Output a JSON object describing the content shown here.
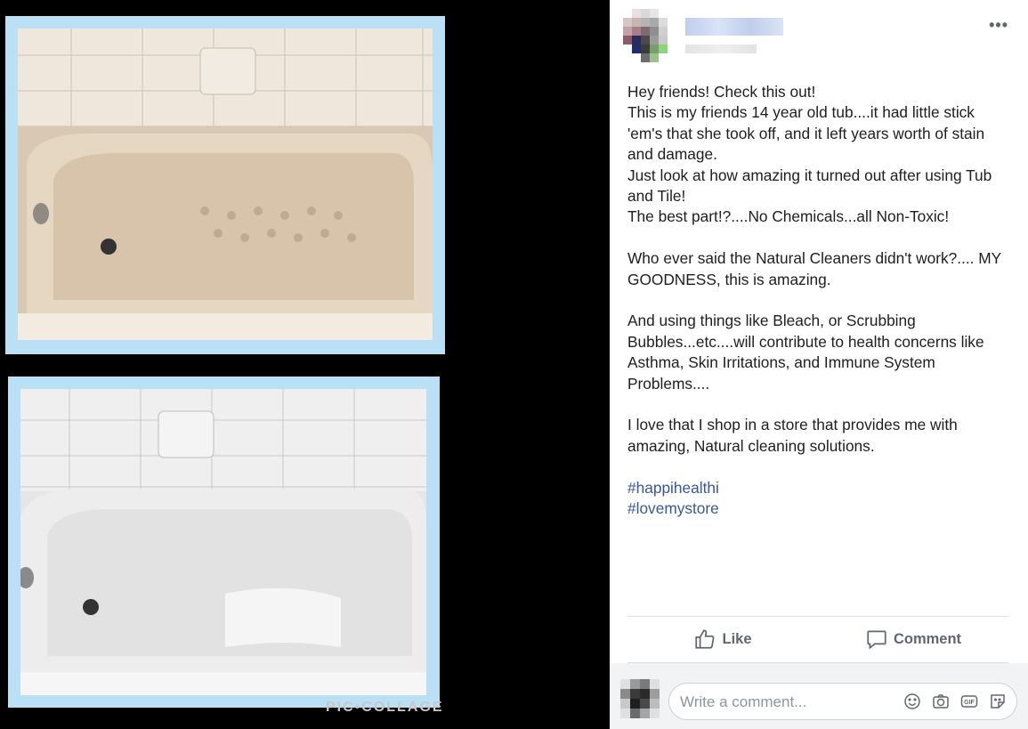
{
  "watermark": "PIC•COLLAGE",
  "post": {
    "more_icon": "more-horizontal-icon",
    "body_lines": [
      "Hey friends! Check this out!",
      "This is my friends 14 year old tub....it had little stick 'em's that she took off, and it left years worth of stain and damage.",
      "Just look at how amazing it turned out after using Tub and Tile!",
      "The best part!?....No Chemicals...all Non-Toxic!",
      "",
      "Who ever said the Natural Cleaners didn't work?.... MY GOODNESS, this is amazing.",
      "",
      "And using things like Bleach, or Scrubbing Bubbles...etc....will contribute to health concerns like Asthma, Skin Irritations, and Immune System Problems....",
      "",
      "I love that I shop in a store that provides me with amazing, Natural cleaning solutions.",
      ""
    ],
    "hashtags": [
      "#happihealthi",
      "#lovemystore"
    ],
    "actions": {
      "like": "Like",
      "comment": "Comment"
    },
    "comment_placeholder": "Write a comment...",
    "colors": {
      "link": "#385898",
      "text": "#1c1e21",
      "muted": "#606770"
    }
  }
}
